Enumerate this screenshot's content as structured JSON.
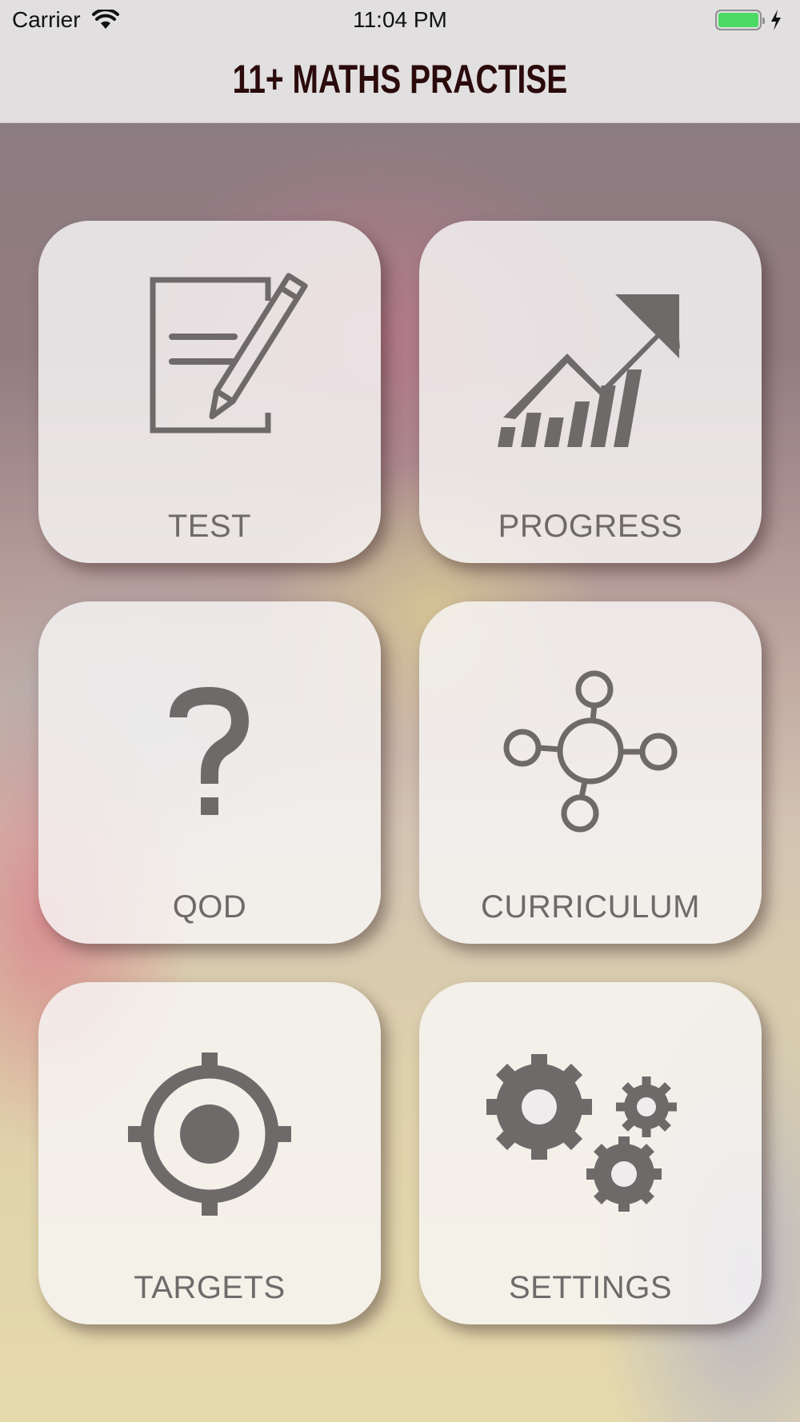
{
  "status_bar": {
    "carrier": "Carrier",
    "time": "11:04 PM",
    "battery_color": "#4cd964"
  },
  "header": {
    "title": "11+ MATHS PRACTISE",
    "title_color": "#2b0a0c"
  },
  "tiles": [
    {
      "label": "TEST",
      "icon": "paper-pencil-icon"
    },
    {
      "label": "PROGRESS",
      "icon": "growth-chart-icon"
    },
    {
      "label": "QOD",
      "icon": "question-mark-icon"
    },
    {
      "label": "CURRICULUM",
      "icon": "network-nodes-icon"
    },
    {
      "label": "TARGETS",
      "icon": "target-crosshair-icon"
    },
    {
      "label": "SETTINGS",
      "icon": "gears-icon"
    }
  ],
  "icon_color": "#6e6a6a"
}
